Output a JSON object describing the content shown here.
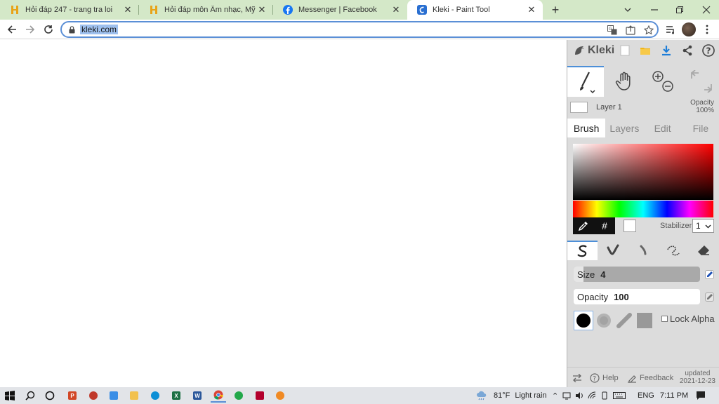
{
  "browser": {
    "tabs": [
      {
        "title": "Hỏi đáp 247 - trang tra loi",
        "icon": "hoidap-h-icon"
      },
      {
        "title": "Hỏi đáp môn Âm nhạc, Mỹ thuật",
        "icon": "hoidap-h-icon"
      },
      {
        "title": "Messenger | Facebook",
        "icon": "facebook-icon"
      },
      {
        "title": "Kleki - Paint Tool",
        "icon": "kleki-icon",
        "active": true
      }
    ],
    "close_glyph": "✕",
    "new_tab_glyph": "+",
    "url": "kleki.com",
    "accent_color": "#d4e8c8"
  },
  "kleki": {
    "brand": "Kleki",
    "layer": {
      "name": "Layer 1",
      "opacity_label": "Opacity",
      "opacity_value": "100%"
    },
    "tabs": [
      "Brush",
      "Layers",
      "Edit",
      "File"
    ],
    "active_tab": "Brush",
    "hex_glyph": "#",
    "stabilizer_label": "Stabilizer",
    "stabilizer_value": "1",
    "size_label": "Size",
    "size_value": "4",
    "opacity_label": "Opacity",
    "opacity_value": "100",
    "lock_alpha_label": "Lock Alpha",
    "footer": {
      "help": "Help",
      "feedback": "Feedback",
      "updated_label": "updated",
      "updated_date": "2021-12-23"
    },
    "colors": {
      "primary": "#000000",
      "secondary": "#ffffff",
      "accent": "#4d8fd8"
    }
  },
  "taskbar": {
    "weather_temp": "81°F",
    "weather_text": "Light rain",
    "language": "ENG",
    "time": "7:11 PM"
  }
}
